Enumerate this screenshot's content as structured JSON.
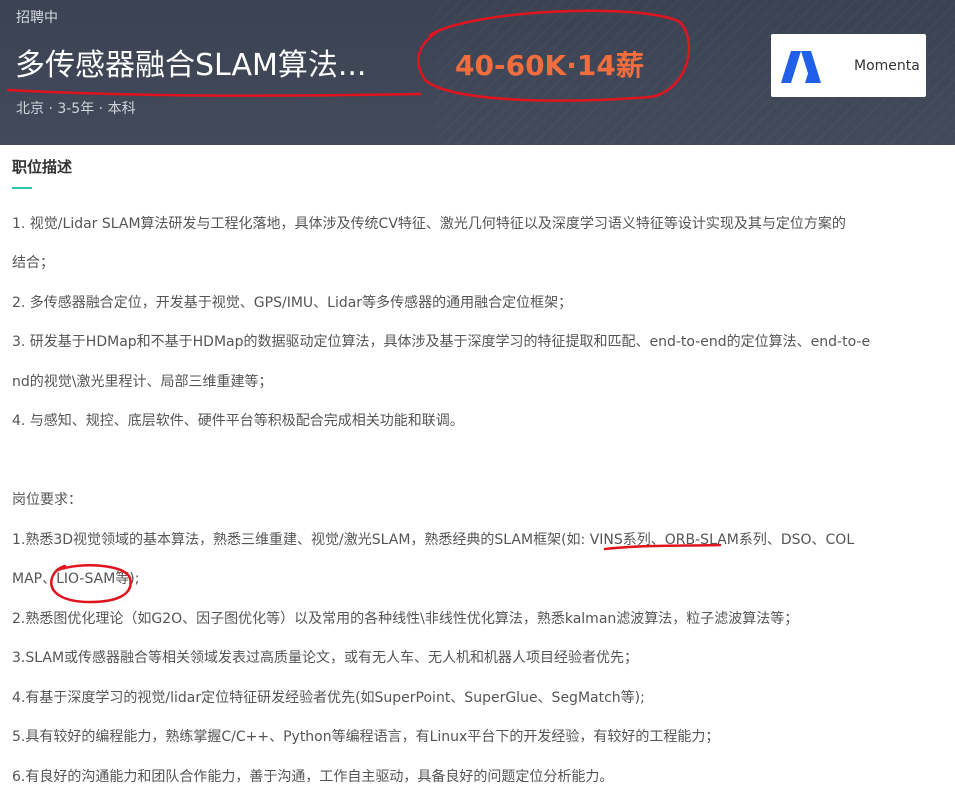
{
  "header": {
    "status": "招聘中",
    "title": "多传感器融合SLAM算法...",
    "salary": "40-60K·14薪",
    "meta": "北京 · 3-5年 · 本科",
    "company": {
      "name": "Momenta",
      "logo_icon": "momenta-logo-icon",
      "logo_color": "#2060e8"
    }
  },
  "section": {
    "title": "职位描述",
    "accent_color": "#2bc4b2"
  },
  "description_lines": [
    "1. 视觉/Lidar SLAM算法研发与工程化落地，具体涉及传统CV特征、激光几何特征以及深度学习语义特征等设计实现及其与定位方案的",
    "结合；",
    "2. 多传感器融合定位，开发基于视觉、GPS/IMU、Lidar等多传感器的通用融合定位框架；",
    "3. 研发基于HDMap和不基于HDMap的数据驱动定位算法，具体涉及基于深度学习的特征提取和匹配、end-to-end的定位算法、end-to-e",
    "nd的视觉\\激光里程计、局部三维重建等；",
    "4. 与感知、规控、底层软件、硬件平台等积极配合完成相关功能和联调。",
    "",
    "岗位要求：",
    "1.熟悉3D视觉领域的基本算法，熟悉三维重建、视觉/激光SLAM，熟悉经典的SLAM框架(如: VINS系列、ORB-SLAM系列、DSO、COL",
    "MAP、LIO-SAM等);",
    "2.熟悉图优化理论（如G2O、因子图优化等）以及常用的各种线性\\非线性优化算法，熟悉kalman滤波算法，粒子滤波算法等；",
    "3.SLAM或传感器融合等相关领域发表过高质量论文，或有无人车、无人机和机器人项目经验者优先；",
    "4.有基于深度学习的视觉/lidar定位特征研发经验者优先(如SuperPoint、SuperGlue、SegMatch等);",
    "5.具有较好的编程能力，熟练掌握C/C++、Python等编程语言，有Linux平台下的开发经验，有较好的工程能力；",
    "6.有良好的沟通能力和团队合作能力，善于沟通，工作自主驱动，具备良好的问题定位分析能力。"
  ],
  "annotation": {
    "color": "#e0141e"
  }
}
